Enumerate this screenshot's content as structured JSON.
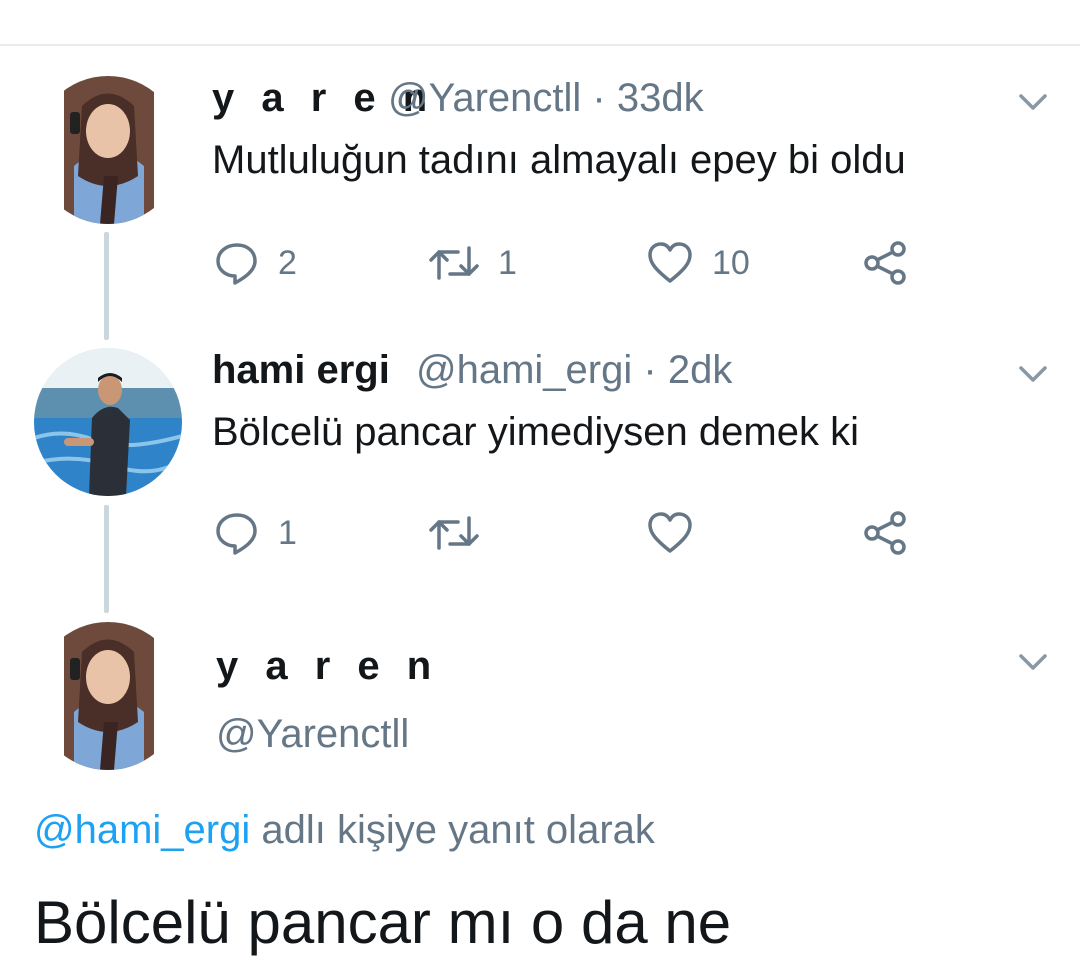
{
  "tweets": [
    {
      "display_name": "y a r e n",
      "handle": "@Yarenctll",
      "time": "33dk",
      "separator": "·",
      "text": "Mutluluğun tadını almayalı epey bi oldu",
      "replies": "2",
      "retweets": "1",
      "likes": "10"
    },
    {
      "display_name": "hami ergi",
      "handle": "@hami_ergi",
      "time": "2dk",
      "separator": "·",
      "text": "Bölcelü pancar yimediysen demek ki",
      "replies": "1",
      "retweets": "",
      "likes": ""
    }
  ],
  "focused": {
    "display_name": "y a r e n",
    "handle": "@Yarenctll",
    "reply_mention": "@hami_ergi",
    "reply_suffix": " adlı kişiye yanıt olarak",
    "text": "Bölcelü pancar mı o da ne"
  },
  "icons": {
    "reply": "reply-bubble-icon",
    "retweet": "retweet-icon",
    "like": "heart-icon",
    "share": "share-icon",
    "menu": "chevron-down-icon"
  },
  "colors": {
    "text": "#14171a",
    "secondary": "#657786",
    "mention": "#1da1f2",
    "thread_line": "#ccd6dd"
  }
}
